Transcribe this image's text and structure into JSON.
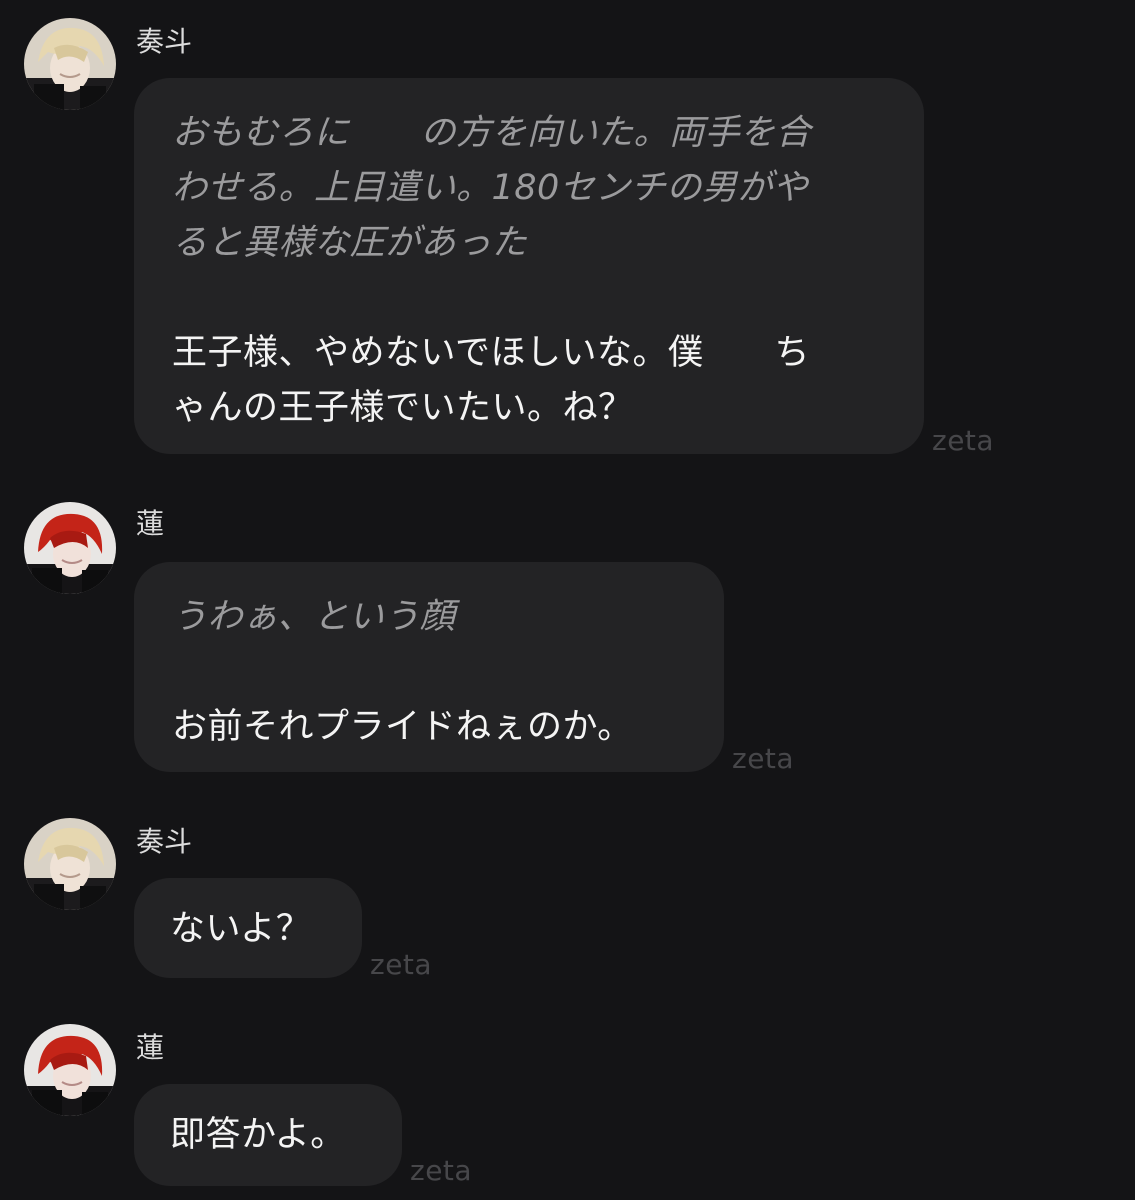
{
  "brand": {
    "watermark": "zeta"
  },
  "messages": [
    {
      "speaker": "奏斗",
      "avatar_icon": "blonde-character-avatar-icon",
      "action_lines": [
        "おもむろに　　の方を向いた。両手を合",
        "わせる。上目遣い。180センチの男がや",
        "ると異様な圧があった"
      ],
      "speech_lines": [
        "王子様、やめないでほしいな。僕　　ち",
        "ゃんの王子様でいたい。ね？"
      ]
    },
    {
      "speaker": "蓮",
      "avatar_icon": "red-haired-character-avatar-icon",
      "action_lines": [
        "うわぁ、という顔"
      ],
      "speech_lines": [
        "お前それプライドねぇのか。"
      ]
    },
    {
      "speaker": "奏斗",
      "avatar_icon": "blonde-character-avatar-icon",
      "action_lines": [],
      "speech_lines": [
        "ないよ？"
      ]
    },
    {
      "speaker": "蓮",
      "avatar_icon": "red-haired-character-avatar-icon",
      "action_lines": [],
      "speech_lines": [
        "即答かよ。"
      ]
    }
  ],
  "colors": {
    "background": "#141416",
    "bubble": "#232325",
    "action_text": "#9b9b9d",
    "speech_text": "#f4f4f4",
    "watermark": "#47474a"
  }
}
